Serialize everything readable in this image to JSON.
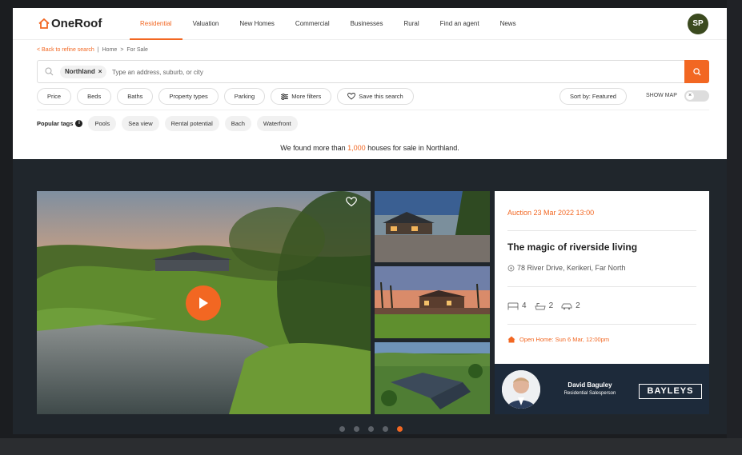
{
  "header": {
    "logo": "OneRoof",
    "nav": [
      "Residential",
      "Valuation",
      "New Homes",
      "Commercial",
      "Businesses",
      "Rural",
      "Find an agent",
      "News"
    ],
    "active_nav": "Residential",
    "avatar": "SP"
  },
  "breadcrumb": {
    "back": "< Back to refine search",
    "sep": "|",
    "home": "Home",
    "arrow": ">",
    "current": "For Sale"
  },
  "search": {
    "chip": "Northland",
    "chip_remove": "×",
    "placeholder": "Type an address, suburb, or city"
  },
  "filters": {
    "price": "Price",
    "beds": "Beds",
    "baths": "Baths",
    "property_types": "Property types",
    "parking": "Parking",
    "more_filters": "More filters",
    "save_search": "Save this search",
    "sort": "Sort by: Featured",
    "show_map": "SHOW MAP",
    "toggle_mark": "×"
  },
  "tags": {
    "label": "Popular tags",
    "info": "i",
    "items": [
      "Pools",
      "Sea view",
      "Rental potential",
      "Bach",
      "Waterfront"
    ]
  },
  "results": {
    "prefix": "We found more than",
    "count": "1,000",
    "suffix": "houses for sale in Northland."
  },
  "listing": {
    "auction": "Auction 23 Mar 2022 13:00",
    "title": "The magic of riverside living",
    "address": "78 River Drive, Kerikeri, Far North",
    "beds": "4",
    "baths": "2",
    "parking": "2",
    "open_home": "Open Home: Sun 6 Mar, 12:00pm"
  },
  "agent": {
    "name": "David Baguley",
    "role": "Residential Salesperson",
    "brand": "BAYLEYS"
  },
  "carousel": {
    "total": 5,
    "active": 5
  },
  "colors": {
    "accent": "#f26722",
    "dark_bg": "#20262c",
    "agent_bg": "#1d2a3a"
  }
}
